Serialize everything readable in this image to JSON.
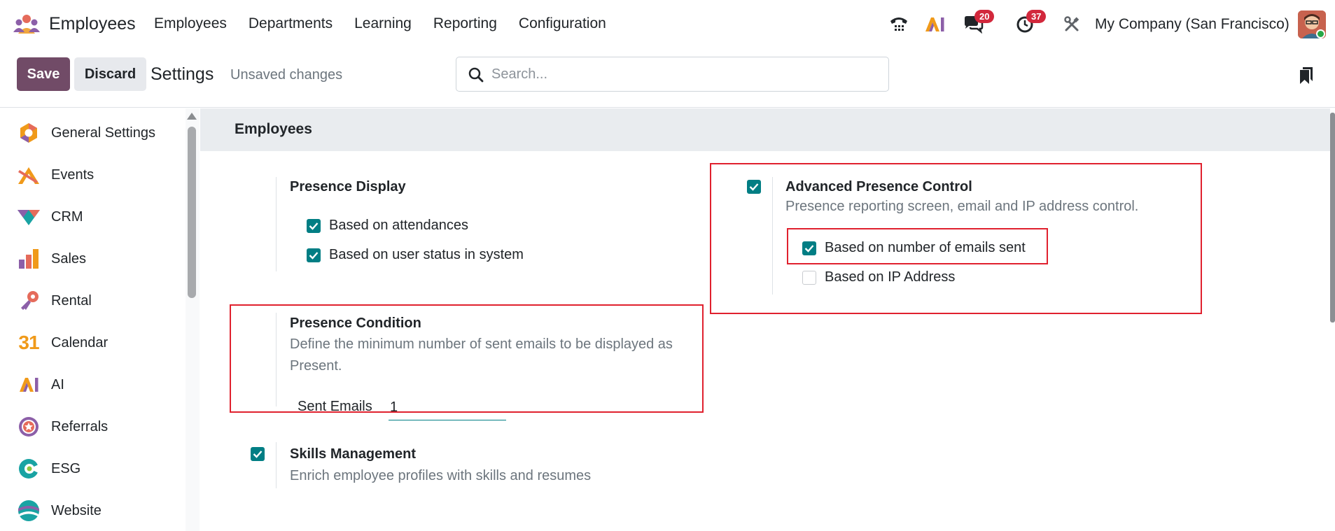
{
  "topbar": {
    "app_name": "Employees",
    "menu": [
      "Employees",
      "Departments",
      "Learning",
      "Reporting",
      "Configuration"
    ],
    "messages_count": "20",
    "activities_count": "37",
    "company": "My Company (San Francisco)",
    "icons": [
      "phone-icon",
      "ai-icon",
      "messages-icon",
      "activity-clock-icon",
      "tools-icon"
    ]
  },
  "controls": {
    "save_label": "Save",
    "discard_label": "Discard",
    "title": "Settings",
    "unsaved": "Unsaved changes",
    "search_placeholder": "Search..."
  },
  "sidebar": {
    "items": [
      {
        "label": "General Settings",
        "icon": "general-settings-icon"
      },
      {
        "label": "Events",
        "icon": "events-icon"
      },
      {
        "label": "CRM",
        "icon": "crm-icon"
      },
      {
        "label": "Sales",
        "icon": "sales-icon"
      },
      {
        "label": "Rental",
        "icon": "rental-icon"
      },
      {
        "label": "Calendar",
        "icon": "calendar-icon"
      },
      {
        "label": "AI",
        "icon": "ai-app-icon"
      },
      {
        "label": "Referrals",
        "icon": "referrals-icon"
      },
      {
        "label": "ESG",
        "icon": "esg-icon"
      },
      {
        "label": "Website",
        "icon": "website-icon"
      }
    ],
    "calendar_icon_text": "31"
  },
  "main": {
    "section_title": "Employees",
    "presence_display": {
      "title": "Presence Display",
      "options": [
        {
          "label": "Based on attendances",
          "checked": true
        },
        {
          "label": "Based on user status in system",
          "checked": true
        }
      ]
    },
    "advanced_presence": {
      "title": "Advanced Presence Control",
      "description": "Presence reporting screen, email and IP address control.",
      "checked": true,
      "options": [
        {
          "label": "Based on number of emails sent",
          "checked": true
        },
        {
          "label": "Based on IP Address",
          "checked": false
        }
      ]
    },
    "presence_condition": {
      "title": "Presence Condition",
      "description_line1": "Define the minimum number of sent emails to be displayed as",
      "description_line2": "Present.",
      "field_label": "Sent Emails",
      "field_value": "1"
    },
    "skills": {
      "title": "Skills Management",
      "description": "Enrich employee profiles with skills and resumes",
      "checked": true
    }
  },
  "colors": {
    "brand": "#714b67",
    "checkbox": "#017e84",
    "highlight": "#e0212e",
    "badge": "#d2283c"
  }
}
